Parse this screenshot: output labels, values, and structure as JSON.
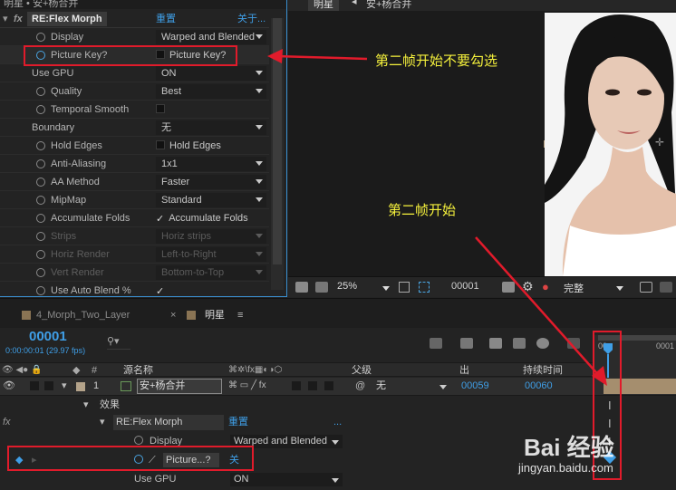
{
  "top_bar": {
    "left_title": "明星 • 安+杨合并",
    "comp_tab": "明星",
    "comp_crumb": "安+杨合并"
  },
  "fx_panel": {
    "effect_name": "RE:Flex Morph",
    "reset": "重置",
    "about": "关于...",
    "rows": [
      {
        "label": "Display",
        "value": "Warped and Blended",
        "type": "dropdown",
        "stopwatch": true
      },
      {
        "label": "Picture Key?",
        "value": "Picture Key?",
        "type": "checkbox",
        "checked": false,
        "stopwatch": true,
        "active": true
      },
      {
        "label": "Use GPU",
        "value": "ON",
        "type": "dropdown",
        "stopwatch": false
      },
      {
        "label": "Quality",
        "value": "Best",
        "type": "dropdown",
        "stopwatch": true
      },
      {
        "label": "Temporal Smooth",
        "value": "",
        "type": "checkbox",
        "checked": false,
        "stopwatch": true
      },
      {
        "label": "Boundary",
        "value": "无",
        "type": "dropdown",
        "stopwatch": false
      },
      {
        "label": "Hold Edges",
        "value": "Hold Edges",
        "type": "checkbox",
        "checked": false,
        "stopwatch": true
      },
      {
        "label": "Anti-Aliasing",
        "value": "1x1",
        "type": "dropdown",
        "stopwatch": true
      },
      {
        "label": "AA Method",
        "value": "Faster",
        "type": "dropdown",
        "stopwatch": true
      },
      {
        "label": "MipMap",
        "value": "Standard",
        "type": "dropdown",
        "stopwatch": true
      },
      {
        "label": "Accumulate Folds",
        "value": "Accumulate Folds",
        "type": "checkbox",
        "checked": true,
        "stopwatch": true
      },
      {
        "label": "Strips",
        "value": "Horiz strips",
        "type": "dropdown",
        "stopwatch": true,
        "disabled": true
      },
      {
        "label": "Horiz Render",
        "value": "Left-to-Right",
        "type": "dropdown",
        "stopwatch": true,
        "disabled": true
      },
      {
        "label": "Vert Render",
        "value": "Bottom-to-Top",
        "type": "dropdown",
        "stopwatch": true,
        "disabled": true
      },
      {
        "label": "Use Auto Blend %",
        "value": "",
        "type": "checkbox",
        "checked": true,
        "stopwatch": true
      }
    ]
  },
  "annotations": {
    "a1": "第二帧开始不要勾选",
    "a2": "第二帧开始"
  },
  "viewer": {
    "zoom": "25%",
    "timecode": "00001",
    "resolution": "完整"
  },
  "timeline": {
    "tabs": [
      "4_Morph_Two_Layer",
      "明星"
    ],
    "current_time": "00001",
    "time_sub": "0:00:00:01 (29.97 fps)",
    "headers": {
      "source": "源名称",
      "parent": "父级",
      "out": "出",
      "duration": "持续时间"
    },
    "ruler": {
      "start": "00",
      "mark": "0001"
    },
    "layer": {
      "num": "1",
      "name": "安+杨合并",
      "parent": "无",
      "out": "00059",
      "duration": "00060"
    },
    "effects_label": "效果",
    "effect_name": "RE:Flex Morph",
    "reset": "重置",
    "more": "...",
    "props": [
      {
        "label": "Display",
        "value": "Warped and Blended"
      },
      {
        "label": "Picture...?",
        "value": "关"
      },
      {
        "label": "Use GPU",
        "value": "ON"
      }
    ]
  },
  "watermark": {
    "brand": "Bai  经验",
    "url": "jingyan.baidu.com"
  }
}
